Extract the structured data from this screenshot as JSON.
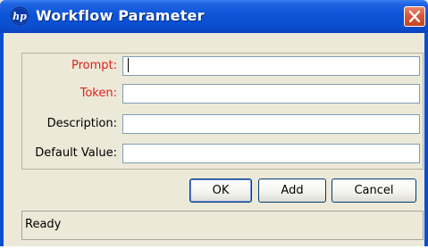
{
  "window": {
    "title": "Workflow Parameter",
    "titlebar_color": "#0a4fd0",
    "close_color": "#d95a3c",
    "icon": "hp-logo-icon"
  },
  "form": {
    "prompt": {
      "label": "Prompt:",
      "value": "",
      "required": true
    },
    "token": {
      "label": "Token:",
      "value": "",
      "required": true
    },
    "description": {
      "label": "Description:",
      "value": ""
    },
    "default_value": {
      "label": "Default Value:",
      "value": ""
    },
    "required_color": "#e02020"
  },
  "buttons": {
    "ok": "OK",
    "add": "Add",
    "cancel": "Cancel"
  },
  "status": {
    "text": "Ready"
  }
}
